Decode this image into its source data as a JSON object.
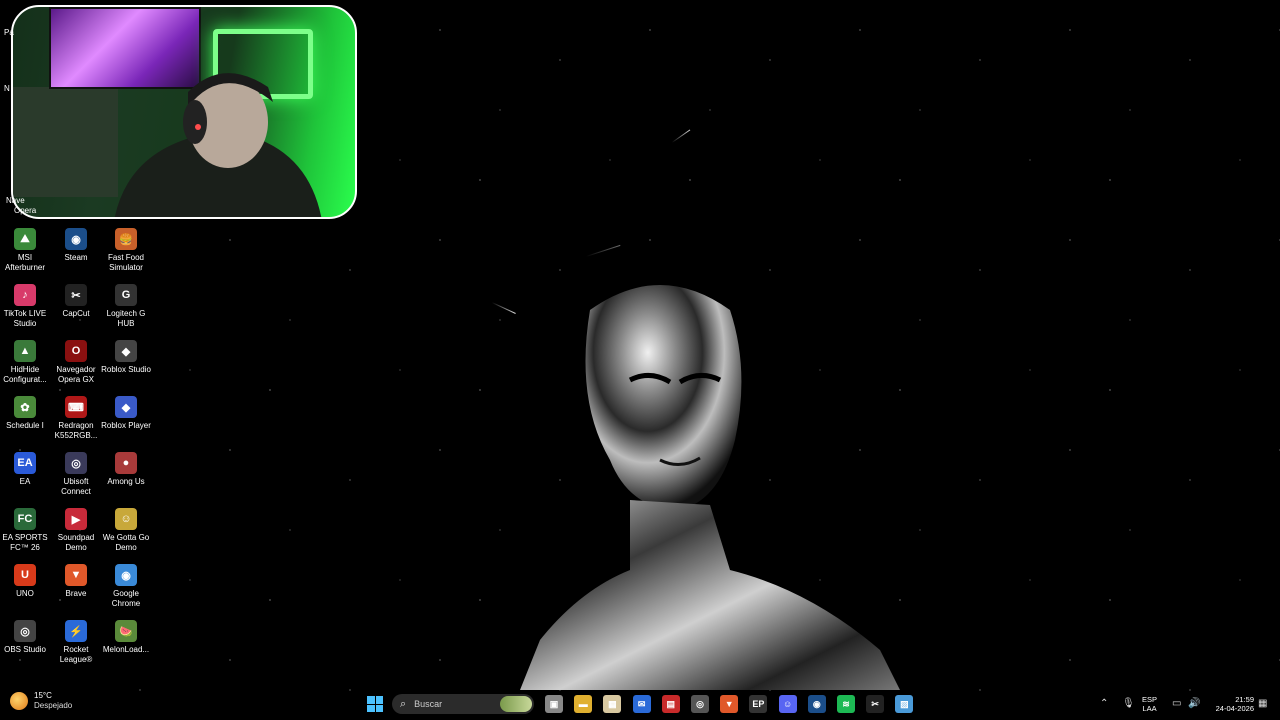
{
  "desktop": {
    "icons": [
      {
        "label": "MSI Afterburner",
        "icon": "msi-afterburner-icon",
        "color": "#3a8a3a",
        "glyph": "⛰"
      },
      {
        "label": "Steam",
        "icon": "steam-icon",
        "color": "#1b4e8a",
        "glyph": "◉"
      },
      {
        "label": "Fast Food Simulator",
        "icon": "fast-food-simulator-icon",
        "color": "#c8602a",
        "glyph": "🍔"
      },
      {
        "label": "TikTok LIVE Studio",
        "icon": "tiktok-live-studio-icon",
        "color": "#d83a6a",
        "glyph": "♪"
      },
      {
        "label": "CapCut",
        "icon": "capcut-icon",
        "color": "#222222",
        "glyph": "✂"
      },
      {
        "label": "Logitech G HUB",
        "icon": "logitech-ghub-icon",
        "color": "#333333",
        "glyph": "G"
      },
      {
        "label": "HidHide Configurat...",
        "icon": "hidhide-icon",
        "color": "#3a7a3a",
        "glyph": "▲"
      },
      {
        "label": "Navegador Opera GX",
        "icon": "opera-gx-icon",
        "color": "#8a1010",
        "glyph": "O"
      },
      {
        "label": "Roblox Studio",
        "icon": "roblox-studio-icon",
        "color": "#444444",
        "glyph": "◆"
      },
      {
        "label": "Schedule I",
        "icon": "schedule-i-icon",
        "color": "#4a8a3a",
        "glyph": "✿"
      },
      {
        "label": "Redragon K552RGB...",
        "icon": "redragon-icon",
        "color": "#b01818",
        "glyph": "⌨"
      },
      {
        "label": "Roblox Player",
        "icon": "roblox-player-icon",
        "color": "#3a5ac8",
        "glyph": "◆"
      },
      {
        "label": "EA",
        "icon": "ea-icon",
        "color": "#2a5ad8",
        "glyph": "EA"
      },
      {
        "label": "Ubisoft Connect",
        "icon": "ubisoft-connect-icon",
        "color": "#3a3a5a",
        "glyph": "◎"
      },
      {
        "label": "Among Us",
        "icon": "among-us-icon",
        "color": "#a83a3a",
        "glyph": "●"
      },
      {
        "label": "EA SPORTS FC™ 26",
        "icon": "ea-sports-fc-icon",
        "color": "#2a6a3a",
        "glyph": "FC"
      },
      {
        "label": "Soundpad Demo",
        "icon": "soundpad-icon",
        "color": "#c82a3a",
        "glyph": "▶"
      },
      {
        "label": "We Gotta Go Demo",
        "icon": "we-gotta-go-icon",
        "color": "#c8a83a",
        "glyph": "☺"
      },
      {
        "label": "UNO",
        "icon": "uno-icon",
        "color": "#d83a1a",
        "glyph": "U"
      },
      {
        "label": "Brave",
        "icon": "brave-icon",
        "color": "#e0582a",
        "glyph": "▼"
      },
      {
        "label": "Google Chrome",
        "icon": "chrome-icon",
        "color": "#3a8ad8",
        "glyph": "◉"
      },
      {
        "label": "OBS Studio",
        "icon": "obs-studio-icon",
        "color": "#444444",
        "glyph": "◎"
      },
      {
        "label": "Rocket League®",
        "icon": "rocket-league-icon",
        "color": "#2a6ad8",
        "glyph": "⚡"
      },
      {
        "label": "MelonLoad...",
        "icon": "melonloader-icon",
        "color": "#5a8a3a",
        "glyph": "🍉"
      }
    ],
    "partial_labels": [
      "Pa",
      "N",
      "Nave",
      "Opera"
    ]
  },
  "taskbar": {
    "weather": {
      "temp": "15°C",
      "condition": "Despejado"
    },
    "search_placeholder": "Buscar",
    "apps": [
      {
        "icon": "task-view-icon",
        "color": "#888888",
        "glyph": "▣"
      },
      {
        "icon": "file-explorer-icon",
        "color": "#e0b030",
        "glyph": "▬"
      },
      {
        "icon": "microsoft-store-icon",
        "color": "#d8c8a0",
        "glyph": "▦"
      },
      {
        "icon": "outlook-icon",
        "color": "#2a6ad8",
        "glyph": "✉"
      },
      {
        "icon": "news-app-icon",
        "color": "#c82a2a",
        "glyph": "▤"
      },
      {
        "icon": "opera-gx-taskbar-icon",
        "color": "#555555",
        "glyph": "◎"
      },
      {
        "icon": "brave-taskbar-icon",
        "color": "#e0582a",
        "glyph": "▼"
      },
      {
        "icon": "epic-games-icon",
        "color": "#333333",
        "glyph": "EP"
      },
      {
        "icon": "discord-icon",
        "color": "#5865f2",
        "glyph": "☺"
      },
      {
        "icon": "steam-taskbar-icon",
        "color": "#1b4e8a",
        "glyph": "◉"
      },
      {
        "icon": "spotify-icon",
        "color": "#1db954",
        "glyph": "≋"
      },
      {
        "icon": "capcut-taskbar-icon",
        "color": "#222222",
        "glyph": "✂"
      },
      {
        "icon": "photos-icon",
        "color": "#4a9ad8",
        "glyph": "▨"
      }
    ],
    "tray": {
      "language_top": "ESP",
      "language_bottom": "LAA",
      "time": "21:59",
      "date": "24-04-2026"
    }
  }
}
